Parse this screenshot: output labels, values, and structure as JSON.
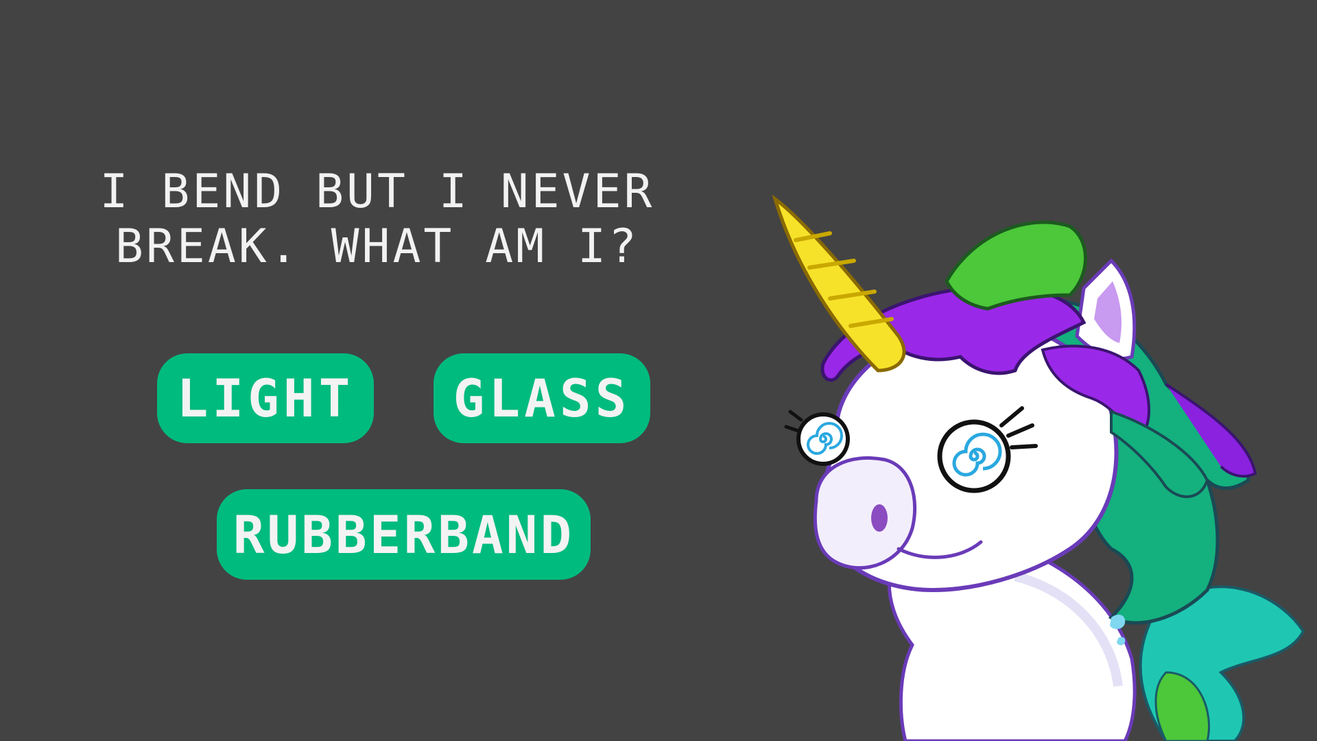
{
  "riddle": {
    "line1": "I BEND BUT I NEVER",
    "line2": "BREAK. WHAT AM I?"
  },
  "answers": [
    {
      "label": "LIGHT"
    },
    {
      "label": "GLASS"
    },
    {
      "label": "RUBBERBAND"
    }
  ],
  "colors": {
    "background": "#434343",
    "button": "#00bb7e",
    "text": "#f2f2f2"
  },
  "character": {
    "icon": "unicorn-icon"
  }
}
